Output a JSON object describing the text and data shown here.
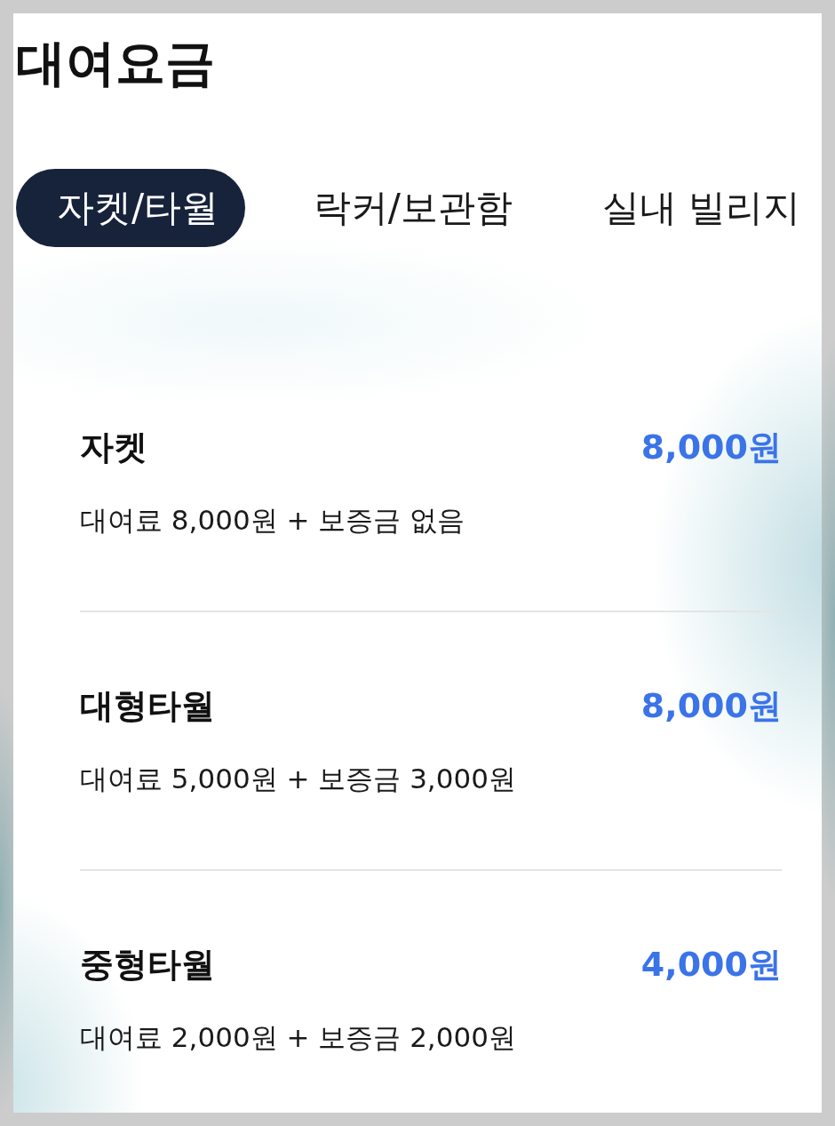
{
  "title": "대여요금",
  "tabs": [
    {
      "label": "자켓/타월",
      "selected": true
    },
    {
      "label": "락커/보관함",
      "selected": false
    },
    {
      "label": "실내 빌리지",
      "selected": false
    }
  ],
  "items": [
    {
      "name": "자켓",
      "price": "8,000원",
      "description": "대여료 8,000원 + 보증금 없음"
    },
    {
      "name": "대형타월",
      "price": "8,000원",
      "description": "대여료 5,000원 + 보증금 3,000원"
    },
    {
      "name": "중형타월",
      "price": "4,000원",
      "description": "대여료 2,000원 + 보증금 2,000원"
    }
  ]
}
